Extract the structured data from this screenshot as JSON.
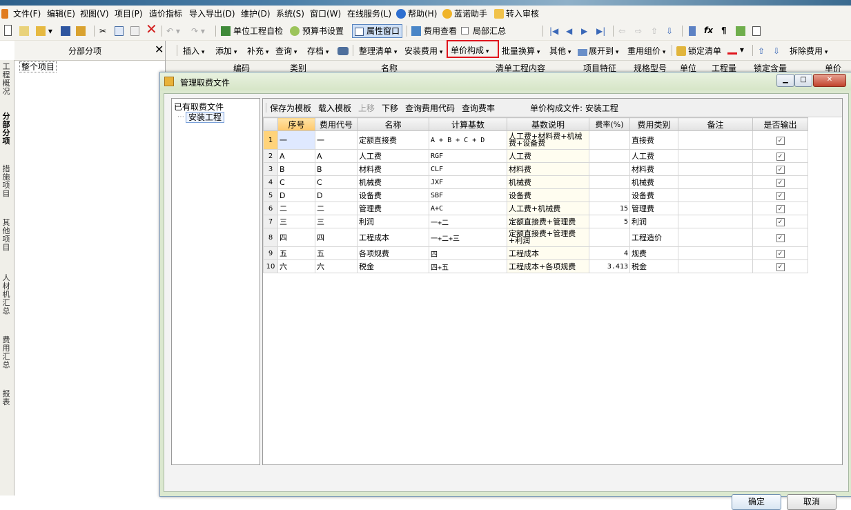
{
  "menubar": {
    "items": [
      "文件(F)",
      "编辑(E)",
      "视图(V)",
      "项目(P)",
      "造价指标",
      "导入导出(D)",
      "维护(D)",
      "系统(S)",
      "窗口(W)",
      "在线服务(L)",
      "帮助(H)",
      "蓝诺助手",
      "转入审核"
    ]
  },
  "toolbar1": {
    "unit_check": "单位工程自检",
    "budget_settings": "预算书设置",
    "property_window": "属性窗口",
    "fee_view": "费用查看",
    "partial_summary": "局部汇总"
  },
  "toolbar2": {
    "insert": "插入",
    "add": "添加",
    "supplement": "补充",
    "query": "查询",
    "archive": "存档",
    "organize_list": "整理清单",
    "install_fee": "安装费用",
    "unit_price_composition": "单价构成",
    "batch_convert": "批量换算",
    "other": "其他",
    "expand_to": "展开到",
    "reuse_group": "重用组价",
    "lock_list": "锁定清单",
    "split_fee": "拆除费用"
  },
  "left_panel": {
    "title": "分部分项",
    "close_symbol": "✕",
    "tree_root": "整个项目"
  },
  "left_tabs": [
    "工程概况",
    "分部分项",
    "措施项目",
    "其他项目",
    "人材机汇总",
    "费用汇总",
    "报表"
  ],
  "bg_grid_headers": [
    "编码",
    "类别",
    "名称",
    "清单工程内容",
    "项目特征",
    "规格型号",
    "单位",
    "工程量",
    "锁定含量",
    "单价"
  ],
  "dialog": {
    "title": "管理取费文件",
    "files_label": "已有取费文件",
    "files": [
      "安装工程"
    ],
    "toolbar": {
      "save_template": "保存为模板",
      "load_template": "载入模板",
      "move_up": "上移",
      "move_down": "下移",
      "query_fee_code": "查询费用代码",
      "query_rate": "查询费率",
      "composition_file_label": "单价构成文件: 安装工程"
    },
    "columns": [
      "序号",
      "费用代号",
      "名称",
      "计算基数",
      "基数说明",
      "费率(%)",
      "费用类别",
      "备注",
      "是否输出"
    ],
    "rows": [
      {
        "n": "1",
        "seq": "一",
        "code": "一",
        "name": "定额直接费",
        "base": "A + B + C + D",
        "desc": "人工费+材料费+机械费+设备费",
        "rate": "",
        "cat": "直接费",
        "note": "",
        "output": true
      },
      {
        "n": "2",
        "seq": "A",
        "code": "A",
        "name": "人工费",
        "base": "RGF",
        "desc": "人工费",
        "rate": "",
        "cat": "人工费",
        "note": "",
        "output": true
      },
      {
        "n": "3",
        "seq": "B",
        "code": "B",
        "name": "材料费",
        "base": "CLF",
        "desc": "材料费",
        "rate": "",
        "cat": "材料费",
        "note": "",
        "output": true
      },
      {
        "n": "4",
        "seq": "C",
        "code": "C",
        "name": "机械费",
        "base": "JXF",
        "desc": "机械费",
        "rate": "",
        "cat": "机械费",
        "note": "",
        "output": true
      },
      {
        "n": "5",
        "seq": "D",
        "code": "D",
        "name": "设备费",
        "base": "SBF",
        "desc": "设备费",
        "rate": "",
        "cat": "设备费",
        "note": "",
        "output": true
      },
      {
        "n": "6",
        "seq": "二",
        "code": "二",
        "name": "管理费",
        "base": "A+C",
        "desc": "人工费+机械费",
        "rate": "15",
        "cat": "管理费",
        "note": "",
        "output": true
      },
      {
        "n": "7",
        "seq": "三",
        "code": "三",
        "name": "利润",
        "base": "一+二",
        "desc": "定额直接费+管理费",
        "rate": "5",
        "cat": "利润",
        "note": "",
        "output": true
      },
      {
        "n": "8",
        "seq": "四",
        "code": "四",
        "name": "工程成本",
        "base": "一+二+三",
        "desc": "定额直接费+管理费+利润",
        "rate": "",
        "cat": "工程造价",
        "note": "",
        "output": true
      },
      {
        "n": "9",
        "seq": "五",
        "code": "五",
        "name": "各项规费",
        "base": "四",
        "desc": "工程成本",
        "rate": "4",
        "cat": "规费",
        "note": "",
        "output": true
      },
      {
        "n": "10",
        "seq": "六",
        "code": "六",
        "name": "税金",
        "base": "四+五",
        "desc": "工程成本+各项规费",
        "rate": "3.413",
        "cat": "税金",
        "note": "",
        "output": true
      }
    ],
    "ok": "确定",
    "cancel": "取消"
  },
  "colors": {
    "dialog_bg": "#dbe8cf",
    "highlight_red": "#e0141c",
    "selected_header": "#ffc86b"
  }
}
